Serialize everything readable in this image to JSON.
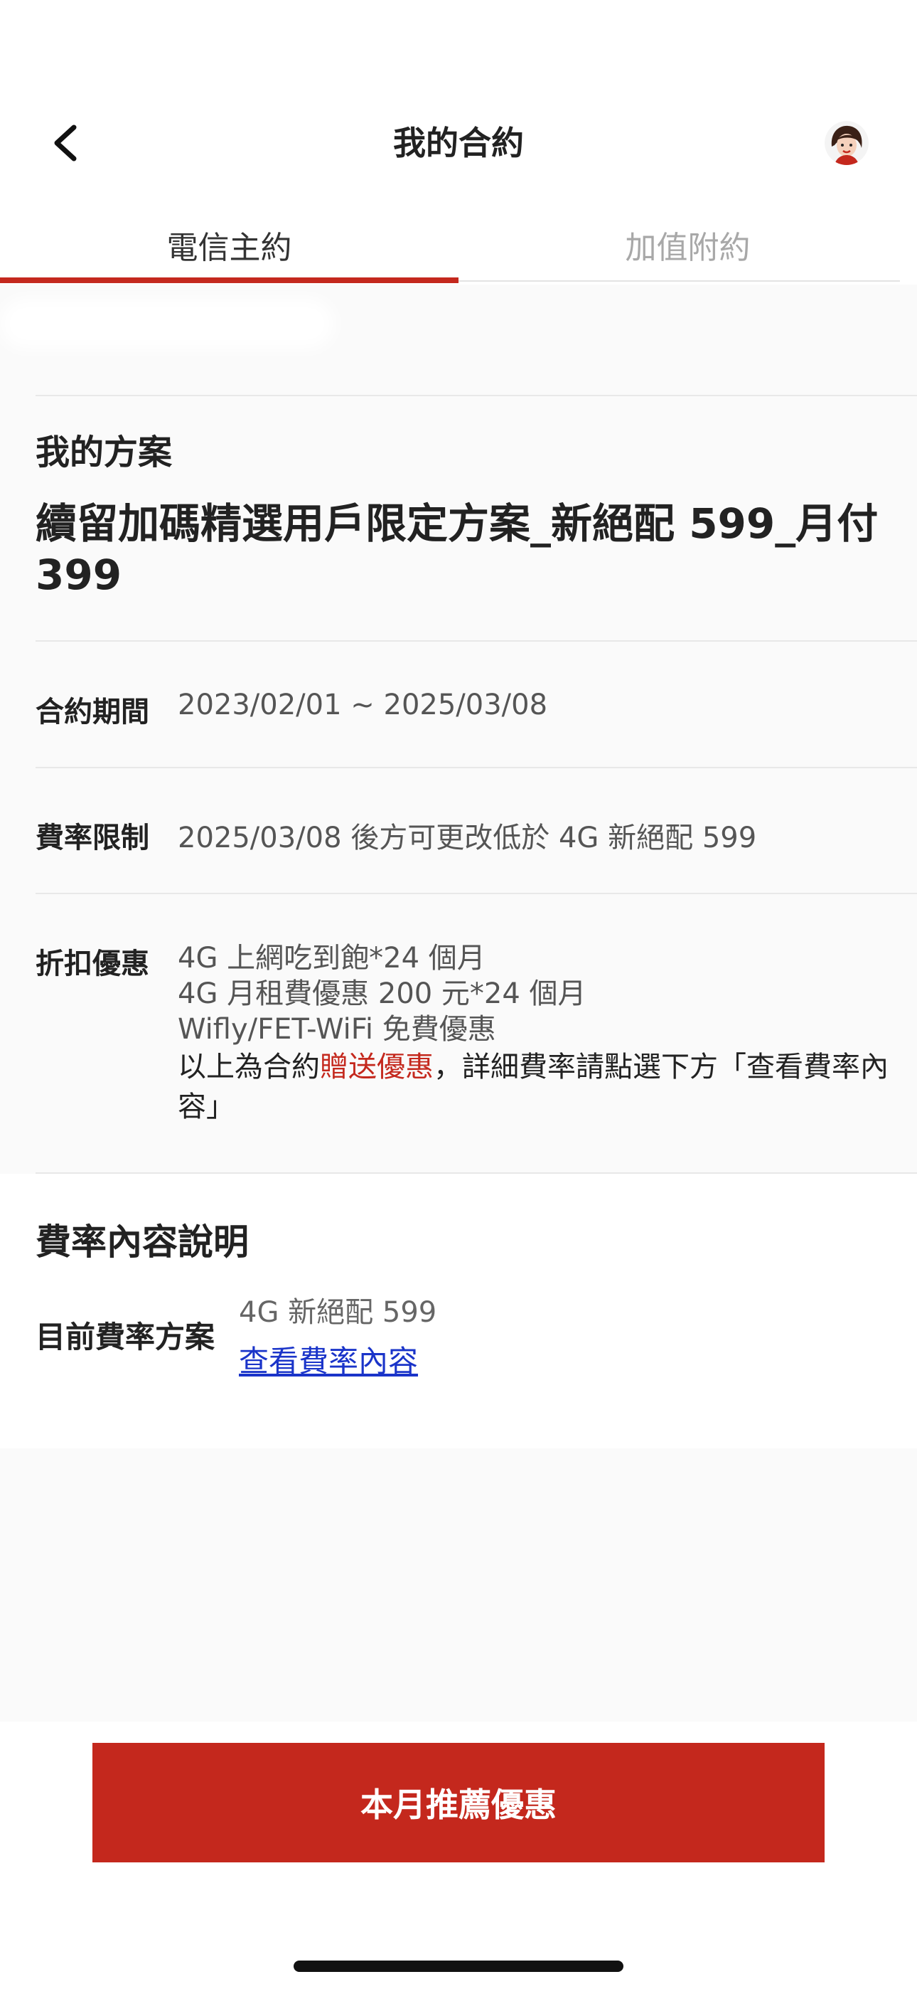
{
  "header": {
    "title": "我的合約"
  },
  "tabs": [
    {
      "label": "電信主約",
      "active": true
    },
    {
      "label": "加值附約",
      "active": false
    }
  ],
  "plan": {
    "section_label": "我的方案",
    "name": "續留加碼精選用戶限定方案_新絕配 599_月付 399"
  },
  "contract": {
    "period_label": "合約期間",
    "period_value": "2023/02/01 ~ 2025/03/08",
    "rate_limit_label": "費率限制",
    "rate_limit_value": "2025/03/08 後方可更改低於 4G 新絕配 599",
    "discount_label": "折扣優惠",
    "discount_items": [
      "4G 上網吃到飽*24 個月",
      "4G 月租費優惠 200 元*24 個月",
      "Wifly/FET-WiFi 免費優惠"
    ],
    "note_prefix": "以上為合約",
    "note_highlight": "贈送優惠",
    "note_suffix": "，詳細費率請點選下方「查看費率內容」"
  },
  "rate": {
    "section_title": "費率內容說明",
    "current_label": "目前費率方案",
    "current_value": "4G 新絕配 599",
    "view_link": "查看費率內容"
  },
  "cta": {
    "label": "本月推薦優惠"
  },
  "colors": {
    "brand_red": "#c4281d",
    "link_blue": "#1a34c9"
  },
  "icons": {
    "back": "chevron-left-icon",
    "avatar": "user-avatar"
  }
}
